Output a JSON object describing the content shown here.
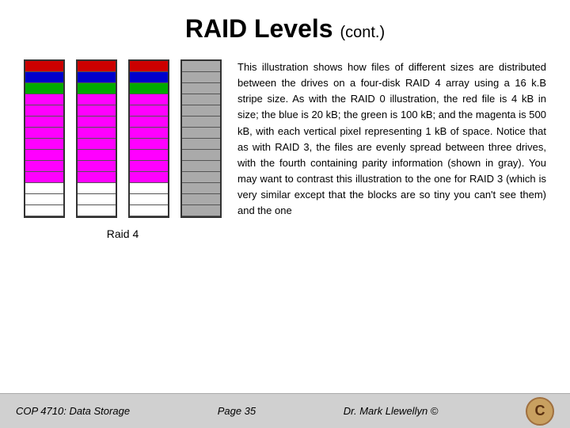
{
  "header": {
    "title": "RAID Levels",
    "subtitle": "(cont.)"
  },
  "diagram": {
    "label": "Raid 4",
    "disks": [
      {
        "id": "disk1",
        "segments": [
          {
            "color": "#cc0000",
            "height": 14
          },
          {
            "color": "#0000cc",
            "height": 14
          },
          {
            "color": "#00aa00",
            "height": 14
          },
          {
            "color": "#ff00ff",
            "height": 14
          },
          {
            "color": "#ff00ff",
            "height": 14
          },
          {
            "color": "#ff00ff",
            "height": 14
          },
          {
            "color": "#ff00ff",
            "height": 14
          },
          {
            "color": "#ff00ff",
            "height": 14
          },
          {
            "color": "#ff00ff",
            "height": 14
          },
          {
            "color": "#ff00ff",
            "height": 14
          },
          {
            "color": "#ff00ff",
            "height": 14
          },
          {
            "color": "#ffffff",
            "height": 14
          },
          {
            "color": "#ffffff",
            "height": 14
          },
          {
            "color": "#ffffff",
            "height": 14
          }
        ]
      },
      {
        "id": "disk2",
        "segments": [
          {
            "color": "#cc0000",
            "height": 14
          },
          {
            "color": "#0000cc",
            "height": 14
          },
          {
            "color": "#00aa00",
            "height": 14
          },
          {
            "color": "#ff00ff",
            "height": 14
          },
          {
            "color": "#ff00ff",
            "height": 14
          },
          {
            "color": "#ff00ff",
            "height": 14
          },
          {
            "color": "#ff00ff",
            "height": 14
          },
          {
            "color": "#ff00ff",
            "height": 14
          },
          {
            "color": "#ff00ff",
            "height": 14
          },
          {
            "color": "#ff00ff",
            "height": 14
          },
          {
            "color": "#ff00ff",
            "height": 14
          },
          {
            "color": "#ffffff",
            "height": 14
          },
          {
            "color": "#ffffff",
            "height": 14
          },
          {
            "color": "#ffffff",
            "height": 14
          }
        ]
      },
      {
        "id": "disk3",
        "segments": [
          {
            "color": "#cc0000",
            "height": 14
          },
          {
            "color": "#0000cc",
            "height": 14
          },
          {
            "color": "#00aa00",
            "height": 14
          },
          {
            "color": "#ff00ff",
            "height": 14
          },
          {
            "color": "#ff00ff",
            "height": 14
          },
          {
            "color": "#ff00ff",
            "height": 14
          },
          {
            "color": "#ff00ff",
            "height": 14
          },
          {
            "color": "#ff00ff",
            "height": 14
          },
          {
            "color": "#ff00ff",
            "height": 14
          },
          {
            "color": "#ff00ff",
            "height": 14
          },
          {
            "color": "#ff00ff",
            "height": 14
          },
          {
            "color": "#ffffff",
            "height": 14
          },
          {
            "color": "#ffffff",
            "height": 14
          },
          {
            "color": "#ffffff",
            "height": 14
          }
        ]
      },
      {
        "id": "disk4-parity",
        "segments": [
          {
            "color": "#aaaaaa",
            "height": 14
          },
          {
            "color": "#aaaaaa",
            "height": 14
          },
          {
            "color": "#aaaaaa",
            "height": 14
          },
          {
            "color": "#aaaaaa",
            "height": 14
          },
          {
            "color": "#aaaaaa",
            "height": 14
          },
          {
            "color": "#aaaaaa",
            "height": 14
          },
          {
            "color": "#aaaaaa",
            "height": 14
          },
          {
            "color": "#aaaaaa",
            "height": 14
          },
          {
            "color": "#aaaaaa",
            "height": 14
          },
          {
            "color": "#aaaaaa",
            "height": 14
          },
          {
            "color": "#aaaaaa",
            "height": 14
          },
          {
            "color": "#aaaaaa",
            "height": 14
          },
          {
            "color": "#aaaaaa",
            "height": 14
          },
          {
            "color": "#aaaaaa",
            "height": 14
          }
        ]
      }
    ]
  },
  "text": {
    "body": "This illustration shows how files of different sizes are distributed between the drives on a four-disk RAID 4 array using a 16 k.B stripe size. As with the RAID 0 illustration, the red file is 4 kB in size; the blue is 20 kB; the green is 100 kB; and the magenta is 500 kB, with each vertical pixel representing 1 kB of space. Notice that as with RAID 3, the files are evenly spread between three drives, with the fourth containing parity information (shown in gray). You may want to contrast this illustration to the one for RAID 3 (which is very similar except that the blocks are so tiny you can't see them) and the one"
  },
  "footer": {
    "left": "COP 4710: Data Storage",
    "center": "Page 35",
    "right": "Dr. Mark Llewellyn ©"
  }
}
